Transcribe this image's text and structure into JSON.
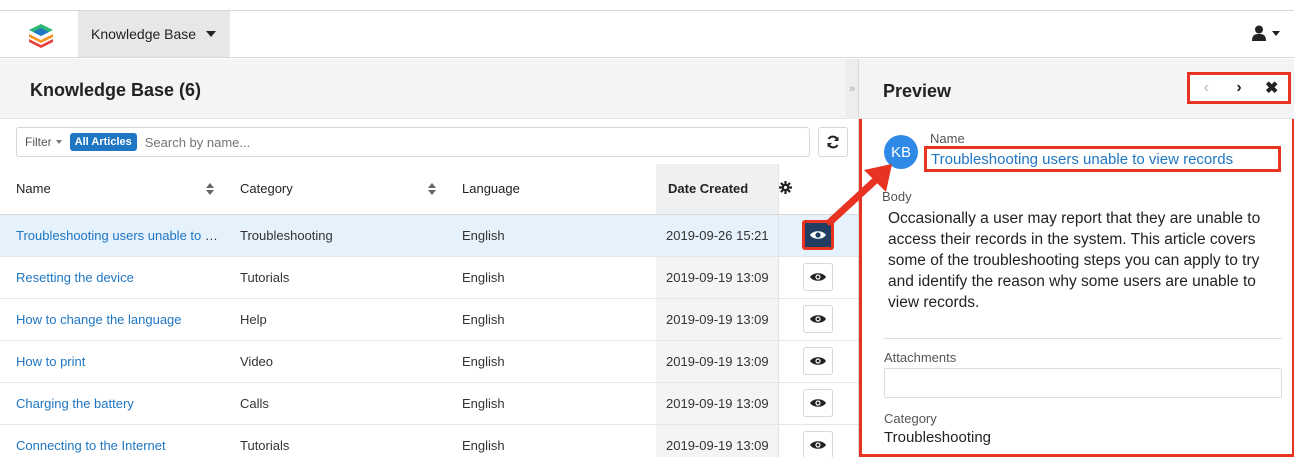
{
  "nav": {
    "module_label": "Knowledge Base"
  },
  "list": {
    "title": "Knowledge Base (6)",
    "filter_label": "Filter",
    "filter_pill": "All Articles",
    "search_placeholder": "Search by name...",
    "columns": {
      "name": "Name",
      "category": "Category",
      "language": "Language",
      "date": "Date Created"
    },
    "rows": [
      {
        "name": "Troubleshooting users unable to view records",
        "category": "Troubleshooting",
        "language": "English",
        "date": "2019-09-26 15:21"
      },
      {
        "name": "Resetting the device",
        "category": "Tutorials",
        "language": "English",
        "date": "2019-09-19 13:09"
      },
      {
        "name": "How to change the language",
        "category": "Help",
        "language": "English",
        "date": "2019-09-19 13:09"
      },
      {
        "name": "How to print",
        "category": "Video",
        "language": "English",
        "date": "2019-09-19 13:09"
      },
      {
        "name": "Charging the battery",
        "category": "Calls",
        "language": "English",
        "date": "2019-09-19 13:09"
      },
      {
        "name": "Connecting to the Internet",
        "category": "Tutorials",
        "language": "English",
        "date": "2019-09-19 13:09"
      }
    ]
  },
  "preview": {
    "title": "Preview",
    "avatar": "KB",
    "name_label": "Name",
    "name_value": "Troubleshooting users unable to view records",
    "body_label": "Body",
    "body_text": "Occasionally a user may report that they are unable to access their records in the system. This article covers some of the troubleshooting steps you can apply to try and identify the reason why some users are unable to view records.",
    "attachments_label": "Attachments",
    "category_label": "Category",
    "category_value": "Troubleshooting"
  },
  "colors": {
    "link": "#1f76c3",
    "highlight": "#e83323",
    "selected_row": "#e5f1fb"
  }
}
